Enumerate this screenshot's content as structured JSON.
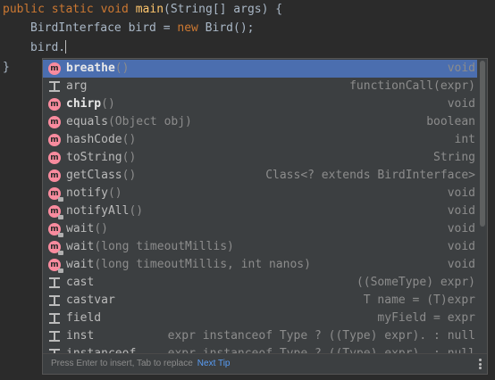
{
  "editor": {
    "line1": {
      "kw": "public static void ",
      "fn": "main",
      "rest": "(String[] args) {"
    },
    "line2": {
      "type": "BirdInterface bird = ",
      "kw": "new",
      "rest": " Bird();"
    },
    "line3": {
      "text": "bird."
    },
    "line4": {
      "text": "}"
    }
  },
  "completion": {
    "items": [
      {
        "icon": "method-icon",
        "name": "breathe",
        "params": "()",
        "type": "void",
        "bold": true,
        "selected": true
      },
      {
        "icon": "template-icon",
        "name": "arg",
        "params": "",
        "type": "functionCall(expr)"
      },
      {
        "icon": "method-icon",
        "name": "chirp",
        "params": "()",
        "type": "void",
        "bold": true
      },
      {
        "icon": "method-icon",
        "name": "equals",
        "params": "(Object obj)",
        "type": "boolean"
      },
      {
        "icon": "method-icon",
        "name": "hashCode",
        "params": "()",
        "type": "int"
      },
      {
        "icon": "method-icon",
        "name": "toString",
        "params": "()",
        "type": "String"
      },
      {
        "icon": "method-icon",
        "name": "getClass",
        "params": "()",
        "type": "Class<? extends BirdInterface>"
      },
      {
        "icon": "method-locked-icon",
        "name": "notify",
        "params": "()",
        "type": "void"
      },
      {
        "icon": "method-locked-icon",
        "name": "notifyAll",
        "params": "()",
        "type": "void"
      },
      {
        "icon": "method-locked-icon",
        "name": "wait",
        "params": "()",
        "type": "void"
      },
      {
        "icon": "method-locked-icon",
        "name": "wait",
        "params": "(long timeoutMillis)",
        "type": "void"
      },
      {
        "icon": "method-locked-icon",
        "name": "wait",
        "params": "(long timeoutMillis, int nanos)",
        "type": "void"
      },
      {
        "icon": "template-icon",
        "name": "cast",
        "params": "",
        "type": "((SomeType) expr)"
      },
      {
        "icon": "template-icon",
        "name": "castvar",
        "params": "",
        "type": "T name = (T)expr"
      },
      {
        "icon": "template-icon",
        "name": "field",
        "params": "",
        "type": "myField = expr"
      },
      {
        "icon": "template-icon",
        "name": "inst",
        "params": "",
        "type": "expr instanceof Type ? ((Type) expr). : null"
      },
      {
        "icon": "template-icon",
        "name": "instanceof",
        "params": "",
        "type": "expr instanceof Type ? ((Type) expr). : null"
      }
    ],
    "footer": {
      "hint": "Press Enter to insert, Tab to replace",
      "link": "Next Tip"
    }
  }
}
